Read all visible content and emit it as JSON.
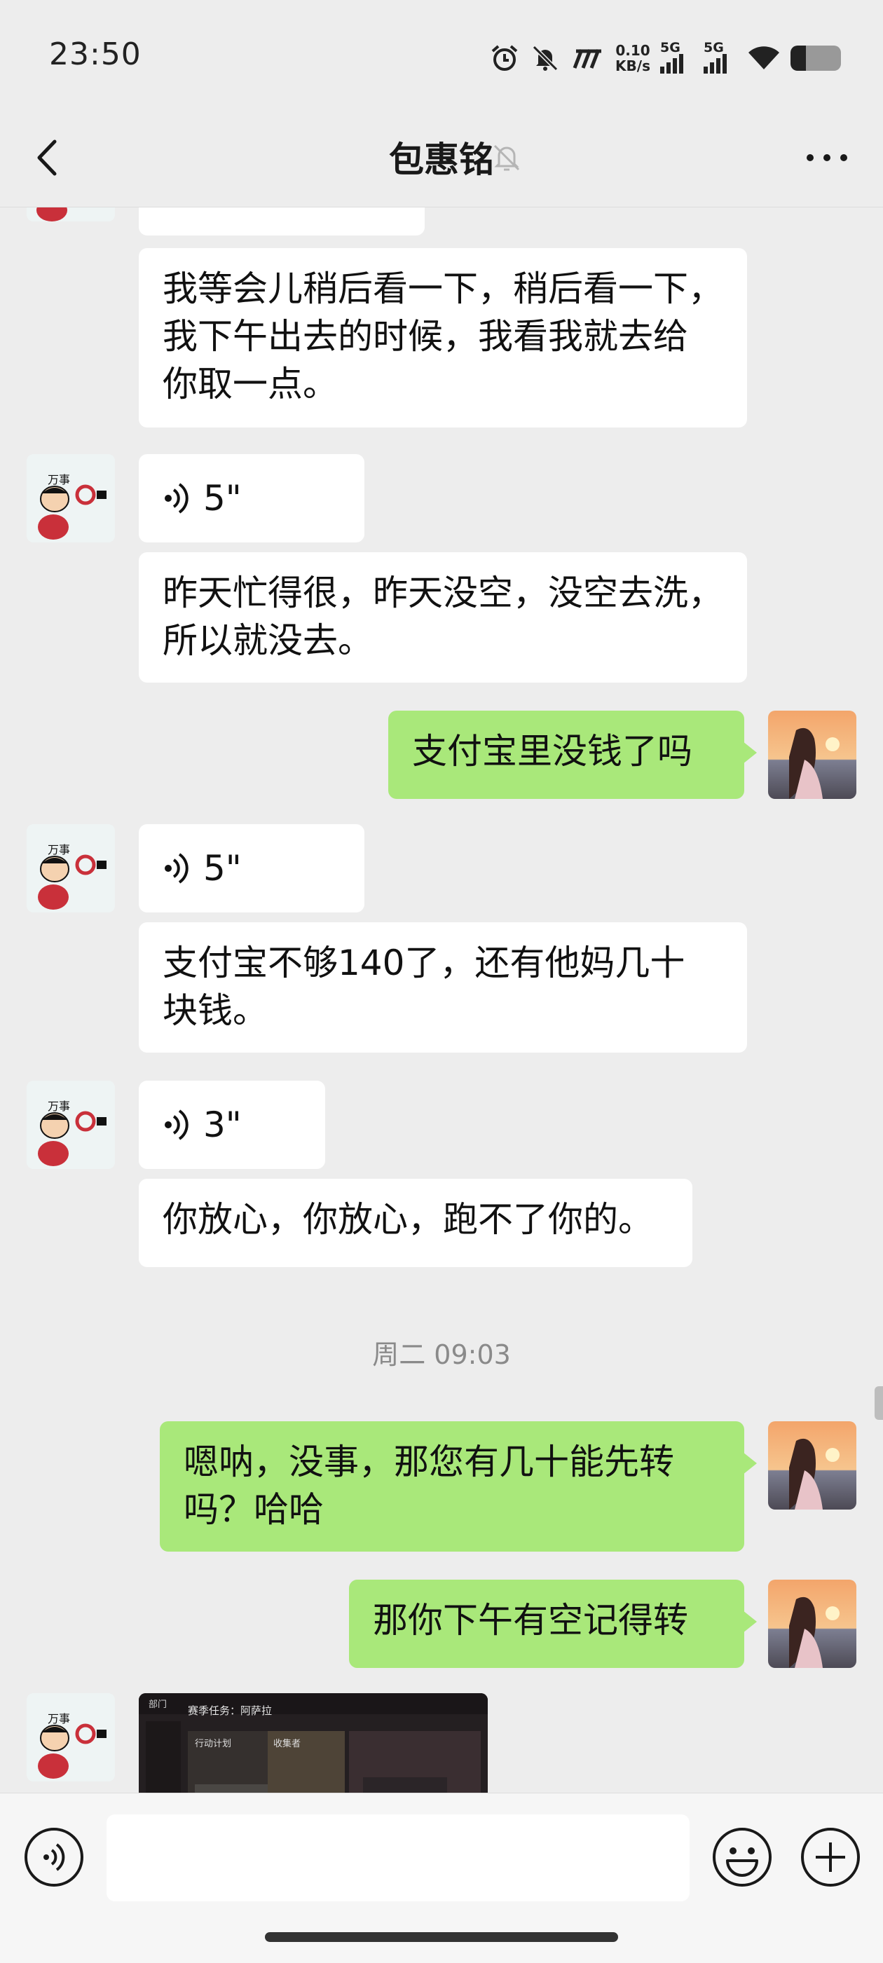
{
  "status_bar": {
    "time": "23:50",
    "net_speed_value": "0.10",
    "net_speed_unit": "KB/s",
    "signal_1_label": "5G",
    "signal_2_label": "5G",
    "battery_level": 0.3
  },
  "header": {
    "title": "包惠铭",
    "muted": true
  },
  "messages": [
    {
      "id": "m0",
      "side": "in",
      "type": "partial"
    },
    {
      "id": "m1",
      "side": "in",
      "type": "text",
      "text": "我等会儿稍后看一下，稍后看一下，\n我下午出去的时候，我看我就去给\n你取一点。"
    },
    {
      "id": "m2",
      "side": "in",
      "type": "voice",
      "duration": "5\""
    },
    {
      "id": "m3",
      "side": "in",
      "type": "text",
      "text": "昨天忙得很，昨天没空，没空去洗，\n所以就没去。"
    },
    {
      "id": "m4",
      "side": "out",
      "type": "text",
      "text": "支付宝里没钱了吗"
    },
    {
      "id": "m5",
      "side": "in",
      "type": "voice",
      "duration": "5\""
    },
    {
      "id": "m6",
      "side": "in",
      "type": "text",
      "text": "支付宝不够140了，还有他妈几十\n块钱。"
    },
    {
      "id": "m7",
      "side": "in",
      "type": "voice",
      "duration": "3\""
    },
    {
      "id": "m8",
      "side": "in",
      "type": "text",
      "text": "你放心，你放心，跑不了你的。"
    },
    {
      "id": "t1",
      "type": "timestamp",
      "text": "周二 09:03"
    },
    {
      "id": "m9",
      "side": "out",
      "type": "text",
      "text": "嗯呐，没事，那您有几十能先转\n吗？哈哈"
    },
    {
      "id": "m10",
      "side": "out",
      "type": "text",
      "text": "那你下午有空记得转"
    },
    {
      "id": "m11",
      "side": "in",
      "type": "image",
      "screenshot_text": {
        "back": "部门",
        "title": "赛季任务：阿萨拉",
        "card_1": "行动计划",
        "card_2": "收集者"
      }
    }
  ],
  "avatars": {
    "contact_caption": "万事"
  },
  "input_bar": {
    "placeholder": ""
  },
  "colors": {
    "background": "#ededed",
    "outgoing_bubble": "#a9e87a",
    "incoming_bubble": "#ffffff"
  }
}
